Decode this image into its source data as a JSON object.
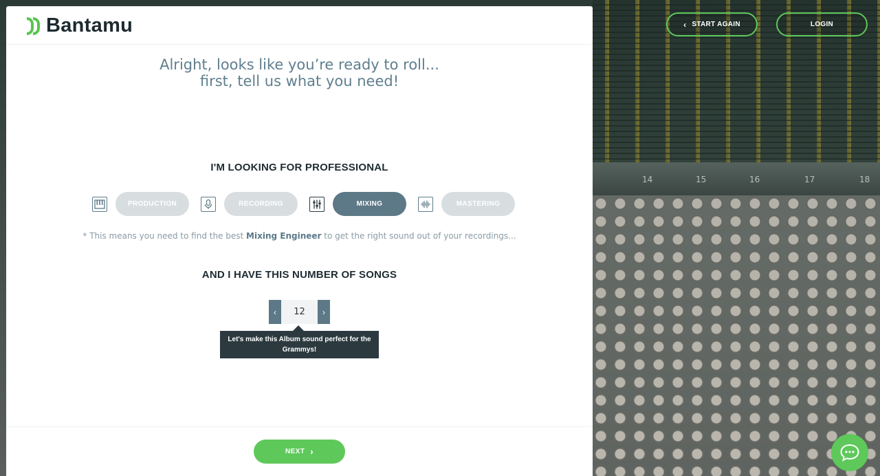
{
  "brand": {
    "name": "Bantamu",
    "accent": "#5ec95a",
    "dark": "#1d2a30",
    "slate": "#5d7886"
  },
  "header": {
    "start_again_label": "START AGAIN",
    "login_label": "LOGIN"
  },
  "intro": {
    "line1": "Alright, looks like you’re ready to roll...",
    "line2": "first, tell us what you need!"
  },
  "services_section": {
    "title": "I'M LOOKING FOR PROFESSIONAL",
    "items": [
      {
        "label": "PRODUCTION",
        "icon": "piano-keys-icon",
        "active": false
      },
      {
        "label": "RECORDING",
        "icon": "microphone-icon",
        "active": false
      },
      {
        "label": "MIXING",
        "icon": "mixer-sliders-icon",
        "active": true
      },
      {
        "label": "MASTERING",
        "icon": "waveform-icon",
        "active": false
      }
    ],
    "note_prefix": "* This means you need to find the best ",
    "note_highlight": "Mixing Engineer",
    "note_suffix": " to get the right sound out of your recordings..."
  },
  "songs_section": {
    "title": "AND I HAVE THIS NUMBER OF SONGS",
    "value": "12",
    "decrement_icon": "chevron-left-icon",
    "increment_icon": "chevron-right-icon",
    "tooltip": "Let's make this Album sound perfect for the Grammys!"
  },
  "footer": {
    "next_label": "NEXT"
  },
  "background": {
    "channel_numbers": [
      "14",
      "15",
      "16",
      "17",
      "18"
    ]
  },
  "chat": {
    "icon": "chat-bubble-icon"
  }
}
